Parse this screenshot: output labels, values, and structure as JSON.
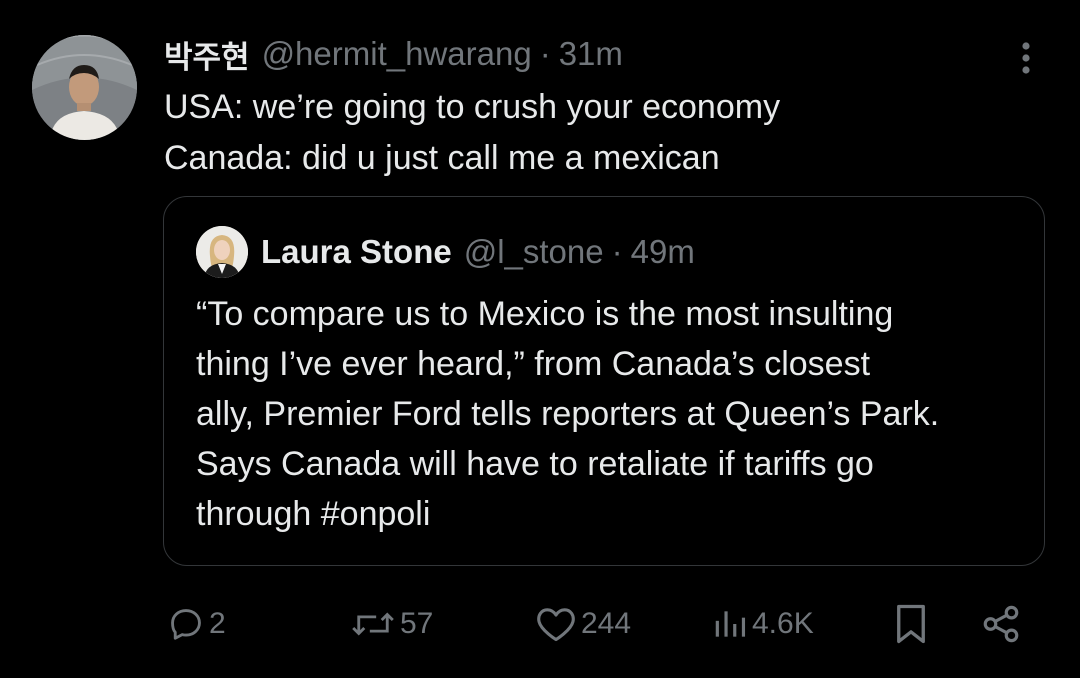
{
  "tweet": {
    "display_name": "박주현",
    "handle": "@hermit_hwarang",
    "separator": "·",
    "time": "31m",
    "text_lines": [
      "USA: we’re going to crush your economy",
      "Canada: did u just call me a mexican"
    ],
    "avatar_icon": "profile-photo-man",
    "more_icon": "more-vertical-icon"
  },
  "quote": {
    "display_name": "Laura Stone",
    "handle": "@l_stone",
    "separator": "·",
    "time": "49m",
    "avatar_icon": "profile-photo-woman",
    "text_lines": [
      "“To compare us to Mexico is the most insulting",
      "thing I’ve ever heard,” from Canada’s closest",
      "ally, Premier Ford tells reporters at Queen’s Park.",
      "Says Canada will have to retaliate if tariffs go",
      "through #onpoli"
    ]
  },
  "actions": {
    "replies": "2",
    "reposts": "57",
    "likes": "244",
    "views": "4.6K"
  },
  "colors": {
    "background": "#000000",
    "text_primary": "#e7e9ea",
    "text_secondary": "#71767b",
    "border": "#333639"
  }
}
